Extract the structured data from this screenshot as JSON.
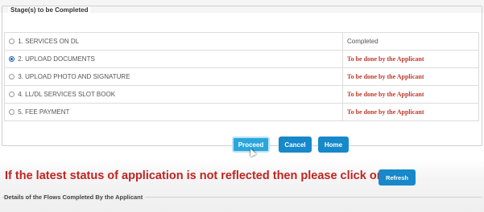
{
  "stages": {
    "legend": "Stage(s) to be Completed",
    "rows": [
      {
        "label": "1.  SERVICES ON DL",
        "status": "Completed",
        "checked": false
      },
      {
        "label": "2.  UPLOAD DOCUMENTS",
        "status": "To be done by the Applicant",
        "checked": true
      },
      {
        "label": "3.  UPLOAD PHOTO AND SIGNATURE",
        "status": "To be done by the Applicant",
        "checked": false
      },
      {
        "label": "4.  LL/DL SERVICES SLOT BOOK",
        "status": "To be done by the Applicant",
        "checked": false
      },
      {
        "label": "5.  FEE PAYMENT",
        "status": "To be done by the Applicant",
        "checked": false
      }
    ]
  },
  "actions": {
    "proceed_label": "Proceed",
    "cancel_label": "Cancel",
    "home_label": "Home"
  },
  "refresh": {
    "message": "If the latest status of application is not reflected then please click on",
    "button_label": "Refresh"
  },
  "details": {
    "legend": "Details of the Flows Completed By the Applicant"
  },
  "colors": {
    "button_blue": "#1788c9",
    "proceed_blue": "#2ba6dc",
    "todo_red": "#c0392b",
    "message_red": "#c0241f"
  },
  "icons": {
    "radio": "radio-button",
    "cursor": "mouse-pointer"
  }
}
